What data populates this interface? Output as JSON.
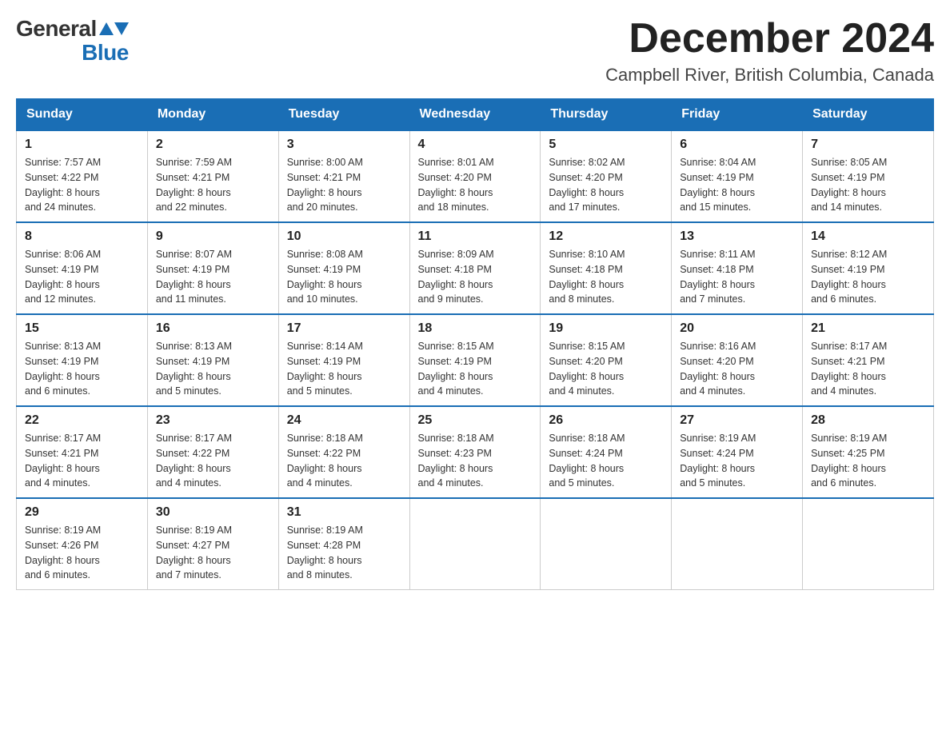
{
  "header": {
    "logo_general": "General",
    "logo_blue": "Blue",
    "month_title": "December 2024",
    "subtitle": "Campbell River, British Columbia, Canada"
  },
  "days_of_week": [
    "Sunday",
    "Monday",
    "Tuesday",
    "Wednesday",
    "Thursday",
    "Friday",
    "Saturday"
  ],
  "weeks": [
    [
      {
        "day": "1",
        "sunrise": "7:57 AM",
        "sunset": "4:22 PM",
        "daylight": "8 hours and 24 minutes."
      },
      {
        "day": "2",
        "sunrise": "7:59 AM",
        "sunset": "4:21 PM",
        "daylight": "8 hours and 22 minutes."
      },
      {
        "day": "3",
        "sunrise": "8:00 AM",
        "sunset": "4:21 PM",
        "daylight": "8 hours and 20 minutes."
      },
      {
        "day": "4",
        "sunrise": "8:01 AM",
        "sunset": "4:20 PM",
        "daylight": "8 hours and 18 minutes."
      },
      {
        "day": "5",
        "sunrise": "8:02 AM",
        "sunset": "4:20 PM",
        "daylight": "8 hours and 17 minutes."
      },
      {
        "day": "6",
        "sunrise": "8:04 AM",
        "sunset": "4:19 PM",
        "daylight": "8 hours and 15 minutes."
      },
      {
        "day": "7",
        "sunrise": "8:05 AM",
        "sunset": "4:19 PM",
        "daylight": "8 hours and 14 minutes."
      }
    ],
    [
      {
        "day": "8",
        "sunrise": "8:06 AM",
        "sunset": "4:19 PM",
        "daylight": "8 hours and 12 minutes."
      },
      {
        "day": "9",
        "sunrise": "8:07 AM",
        "sunset": "4:19 PM",
        "daylight": "8 hours and 11 minutes."
      },
      {
        "day": "10",
        "sunrise": "8:08 AM",
        "sunset": "4:19 PM",
        "daylight": "8 hours and 10 minutes."
      },
      {
        "day": "11",
        "sunrise": "8:09 AM",
        "sunset": "4:18 PM",
        "daylight": "8 hours and 9 minutes."
      },
      {
        "day": "12",
        "sunrise": "8:10 AM",
        "sunset": "4:18 PM",
        "daylight": "8 hours and 8 minutes."
      },
      {
        "day": "13",
        "sunrise": "8:11 AM",
        "sunset": "4:18 PM",
        "daylight": "8 hours and 7 minutes."
      },
      {
        "day": "14",
        "sunrise": "8:12 AM",
        "sunset": "4:19 PM",
        "daylight": "8 hours and 6 minutes."
      }
    ],
    [
      {
        "day": "15",
        "sunrise": "8:13 AM",
        "sunset": "4:19 PM",
        "daylight": "8 hours and 6 minutes."
      },
      {
        "day": "16",
        "sunrise": "8:13 AM",
        "sunset": "4:19 PM",
        "daylight": "8 hours and 5 minutes."
      },
      {
        "day": "17",
        "sunrise": "8:14 AM",
        "sunset": "4:19 PM",
        "daylight": "8 hours and 5 minutes."
      },
      {
        "day": "18",
        "sunrise": "8:15 AM",
        "sunset": "4:19 PM",
        "daylight": "8 hours and 4 minutes."
      },
      {
        "day": "19",
        "sunrise": "8:15 AM",
        "sunset": "4:20 PM",
        "daylight": "8 hours and 4 minutes."
      },
      {
        "day": "20",
        "sunrise": "8:16 AM",
        "sunset": "4:20 PM",
        "daylight": "8 hours and 4 minutes."
      },
      {
        "day": "21",
        "sunrise": "8:17 AM",
        "sunset": "4:21 PM",
        "daylight": "8 hours and 4 minutes."
      }
    ],
    [
      {
        "day": "22",
        "sunrise": "8:17 AM",
        "sunset": "4:21 PM",
        "daylight": "8 hours and 4 minutes."
      },
      {
        "day": "23",
        "sunrise": "8:17 AM",
        "sunset": "4:22 PM",
        "daylight": "8 hours and 4 minutes."
      },
      {
        "day": "24",
        "sunrise": "8:18 AM",
        "sunset": "4:22 PM",
        "daylight": "8 hours and 4 minutes."
      },
      {
        "day": "25",
        "sunrise": "8:18 AM",
        "sunset": "4:23 PM",
        "daylight": "8 hours and 4 minutes."
      },
      {
        "day": "26",
        "sunrise": "8:18 AM",
        "sunset": "4:24 PM",
        "daylight": "8 hours and 5 minutes."
      },
      {
        "day": "27",
        "sunrise": "8:19 AM",
        "sunset": "4:24 PM",
        "daylight": "8 hours and 5 minutes."
      },
      {
        "day": "28",
        "sunrise": "8:19 AM",
        "sunset": "4:25 PM",
        "daylight": "8 hours and 6 minutes."
      }
    ],
    [
      {
        "day": "29",
        "sunrise": "8:19 AM",
        "sunset": "4:26 PM",
        "daylight": "8 hours and 6 minutes."
      },
      {
        "day": "30",
        "sunrise": "8:19 AM",
        "sunset": "4:27 PM",
        "daylight": "8 hours and 7 minutes."
      },
      {
        "day": "31",
        "sunrise": "8:19 AM",
        "sunset": "4:28 PM",
        "daylight": "8 hours and 8 minutes."
      },
      null,
      null,
      null,
      null
    ]
  ],
  "labels": {
    "sunrise": "Sunrise:",
    "sunset": "Sunset:",
    "daylight": "Daylight:"
  }
}
